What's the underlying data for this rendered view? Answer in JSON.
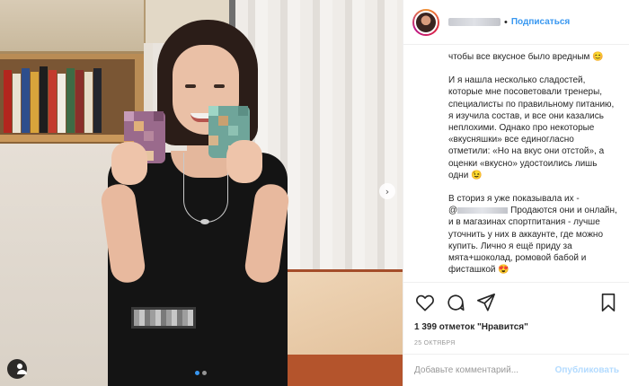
{
  "header": {
    "follow_label": "Подписаться",
    "separator": "•"
  },
  "caption": {
    "line_top": "чтобы все вкусное было вредным 😊",
    "para1": "И я нашла несколько сладостей, которые мне посоветовали тренеры, специалисты по правильному питанию, я изучила состав, и все они казались неплохими. Однако про некоторые «вкусняшки» все единогласно отметили: «Но на вкус они отстой», а оценки «вкусно» удостоились лишь одни 😉",
    "para2_prefix": "В сториз я уже показывала их -",
    "para2_mention_prefix": "@",
    "para2_rest": "Продаются они и онлайн, и в магазинах спортпитания - лучше уточнить у них в аккаунте, где можно купить. Лично я ещё приду за мята+шоколад, ромовой бабой и фисташкой 😍"
  },
  "post": {
    "likes_text": "1 399 отметок \"Нравится\"",
    "date_text": "25 ОКТЯБРЯ"
  },
  "comment": {
    "placeholder": "Добавьте комментарий...",
    "publish_label": "Опубликовать"
  },
  "carousel": {
    "next_glyph": "›",
    "slide_count": 2,
    "active_slide": 1
  },
  "colors": {
    "accent": "#3897f0",
    "publish_disabled": "#b3dbff",
    "text": "#262626",
    "muted": "#999999"
  },
  "icons": [
    "heart-icon",
    "comment-icon",
    "share-icon",
    "bookmark-icon",
    "user-tag-icon",
    "chevron-right-icon"
  ]
}
